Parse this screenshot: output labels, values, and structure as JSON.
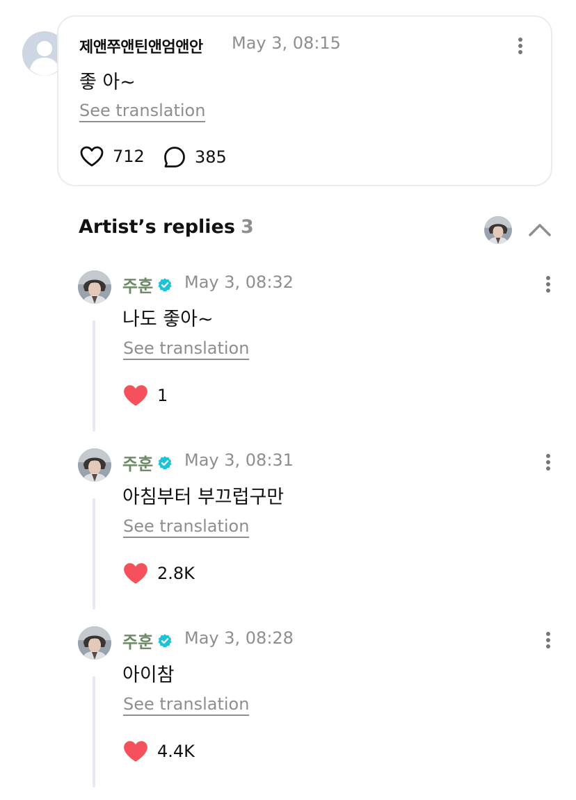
{
  "comment": {
    "username": "제앤쭈앤틴앤엄앤안",
    "time": "May 3, 08:15",
    "text": "좋 아~",
    "see_translation": "See translation",
    "likes": "712",
    "replies": "385"
  },
  "artist_replies": {
    "title": "Artist’s replies",
    "count": "3",
    "items": [
      {
        "name": "주훈",
        "time": "May 3, 08:32",
        "text": "나도 좋아~",
        "see_translation": "See translation",
        "likes": "1"
      },
      {
        "name": "주훈",
        "time": "May 3, 08:31",
        "text": "아침부터 부끄럽구만",
        "see_translation": "See translation",
        "likes": "2.8K"
      },
      {
        "name": "주훈",
        "time": "May 3, 08:28",
        "text": "아이참",
        "see_translation": "See translation",
        "likes": "4.4K"
      }
    ]
  },
  "colors": {
    "artist_name": "#6f8a67",
    "verified_badge": "#1fc1d6",
    "liked_heart": "#f5515c",
    "muted_text": "#8e8e8e"
  },
  "icons": [
    "more-vertical-icon",
    "heart-outline-icon",
    "comment-bubble-icon",
    "verified-badge-icon",
    "chevron-up-icon",
    "heart-filled-icon"
  ]
}
